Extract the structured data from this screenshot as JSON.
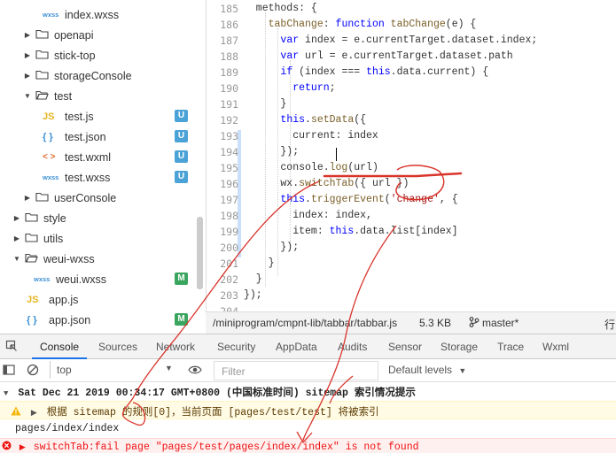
{
  "file_tree": [
    {
      "label": "index.wxss",
      "icon": "wxss",
      "badge": ""
    },
    {
      "label": "openapi",
      "icon": "folder",
      "badge": ""
    },
    {
      "label": "stick-top",
      "icon": "folder",
      "badge": ""
    },
    {
      "label": "storageConsole",
      "icon": "folder",
      "badge": ""
    },
    {
      "label": "test",
      "icon": "folder-open",
      "badge": ""
    },
    {
      "label": "test.js",
      "icon": "js",
      "badge": "U"
    },
    {
      "label": "test.json",
      "icon": "json",
      "badge": "U"
    },
    {
      "label": "test.wxml",
      "icon": "wxml",
      "badge": "U"
    },
    {
      "label": "test.wxss",
      "icon": "wxss",
      "badge": "U"
    },
    {
      "label": "userConsole",
      "icon": "folder",
      "badge": ""
    },
    {
      "label": "style",
      "icon": "folder",
      "badge": ""
    },
    {
      "label": "utils",
      "icon": "folder",
      "badge": ""
    },
    {
      "label": "weui-wxss",
      "icon": "folder-open",
      "badge": ""
    },
    {
      "label": "weui.wxss",
      "icon": "wxss",
      "badge": "M"
    },
    {
      "label": "app.js",
      "icon": "js",
      "badge": ""
    },
    {
      "label": "app.json",
      "icon": "json",
      "badge": "M"
    }
  ],
  "icon_glyphs": {
    "js": "JS",
    "json": "{ }",
    "wxml": "< >",
    "wxss": "wxss"
  },
  "editor": {
    "line_numbers": [
      "185",
      "186",
      "187",
      "188",
      "189",
      "190",
      "191",
      "192",
      "193",
      "194",
      "195",
      "196",
      "197",
      "198",
      "199",
      "200",
      "201",
      "202",
      "203",
      "204"
    ],
    "lines": [
      "  methods: {",
      "    tabChange: function tabChange(e) {",
      "      var index = e.currentTarget.dataset.index;",
      "      var url = e.currentTarget.dataset.path",
      "      if (index === this.data.current) {",
      "        return;",
      "      }",
      "      this.setData({",
      "        current: index",
      "      });",
      "      console.log(url)",
      "      wx.switchTab({ url })",
      "      this.triggerEvent('change', {",
      "        index: index,",
      "        item: this.data.list[index]",
      "      });",
      "    }",
      "  }",
      "});",
      ""
    ]
  },
  "status_bar": {
    "path": "/miniprogram/cmpnt-lib/tabbar/tabbar.js",
    "size": "5.3 KB",
    "branch": "master*",
    "line_label": "行"
  },
  "devtools": {
    "tabs": [
      "Console",
      "Sources",
      "Network",
      "Security",
      "AppData",
      "Audits",
      "Sensor",
      "Storage",
      "Trace",
      "Wxml"
    ],
    "active_tab": "Console",
    "context": "top",
    "filter_placeholder": "Filter",
    "levels": "Default levels"
  },
  "console": {
    "group_header": "Sat Dec 21 2019 00:34:17 GMT+0800 (中国标准时间) sitemap 索引情况提示",
    "warning": "根据 sitemap 的规则[0]，当前页面 [pages/test/test] 将被索引",
    "log": "pages/index/index",
    "error": "switchTab:fail page \"pages/test/pages/index/index\" is not found"
  },
  "colors": {
    "accent": "#1a73e8",
    "annotation": "#d9342b",
    "badge_u": "#4aa2d6",
    "badge_m": "#3aa55f",
    "error": "#e11111",
    "warning_bg": "#fffbe5"
  }
}
